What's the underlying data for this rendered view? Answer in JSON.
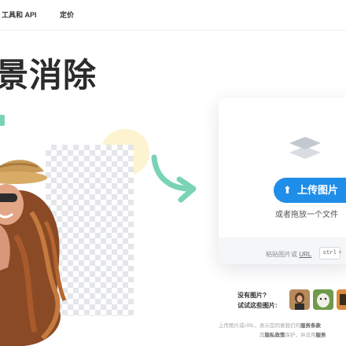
{
  "nav": {
    "tools_api": "工具和 API",
    "pricing": "定价"
  },
  "hero": {
    "title": "景消除"
  },
  "upload": {
    "button_label": "上传图片",
    "drop_text": "或者拖放一个文件",
    "paste_prefix": "粘贴图片或",
    "paste_url": "URL",
    "kbd": "ctrl",
    "kbd_plus": "+"
  },
  "samples": {
    "title": "没有图片?",
    "subtitle": "试试这些图片:"
  },
  "legal": {
    "line1_prefix": "上传图片或URL，表示您同意我们的",
    "line1_bold": "服务条款",
    "line2_prefix": "其",
    "line2_bold": "隐私政策",
    "line2_mid": "保护，并适用",
    "line2_bold2": "服务"
  },
  "colors": {
    "accent": "#1f8ee8",
    "arrow": "#7ad3b6"
  }
}
